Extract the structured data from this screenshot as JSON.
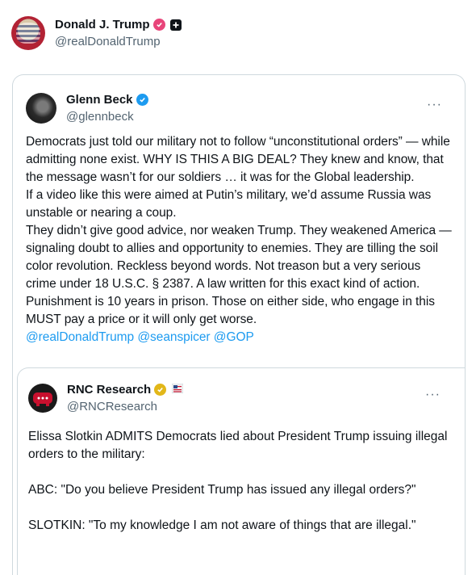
{
  "outer_post": {
    "author": "Donald J. Trump",
    "handle": "@realDonaldTrump"
  },
  "quoted_post": {
    "author": "Glenn Beck",
    "handle": "@glennbeck",
    "text": "Democrats just told our military not to follow “unconstitutional orders” — while admitting none exist. WHY IS THIS A BIG DEAL?  They knew and know, that the message wasn’t for our soldiers … it was for the Global leadership.\nIf a video like this were aimed at Putin’s military, we’d assume Russia was unstable or nearing a coup.\nThey didn’t give good advice, nor weaken Trump. They weakened America — signaling doubt to allies and opportunity to enemies. They are tilling the soil color revolution.  Reckless beyond words. Not treason but a very serious crime under 18 U.S.C. § 2387.  A law written for this exact kind of action.  Punishment is 10 years in prison.   Those on either side, who engage in this MUST pay a price or it will only get worse.",
    "mentions": [
      "@realDonaldTrump",
      "@seanspicer",
      "@GOP"
    ],
    "more_label": "···"
  },
  "nested_post": {
    "author": "RNC Research",
    "handle": "@RNCResearch",
    "text": "Elissa Slotkin ADMITS Democrats lied about President Trump issuing illegal orders to the military:\n\nABC: \"Do you believe President Trump has issued any illegal orders?\"\n\nSLOTKIN: \"To my knowledge I am not aware of things that are illegal.\"",
    "more_label": "···"
  },
  "colors": {
    "text": "#0f1419",
    "secondary": "#536471",
    "link": "#1d9bf0",
    "border": "#cfd9de",
    "verified_blue": "#1d9bf0",
    "verified_gold": "#e2b719",
    "badge_pink": "#e8457a"
  }
}
